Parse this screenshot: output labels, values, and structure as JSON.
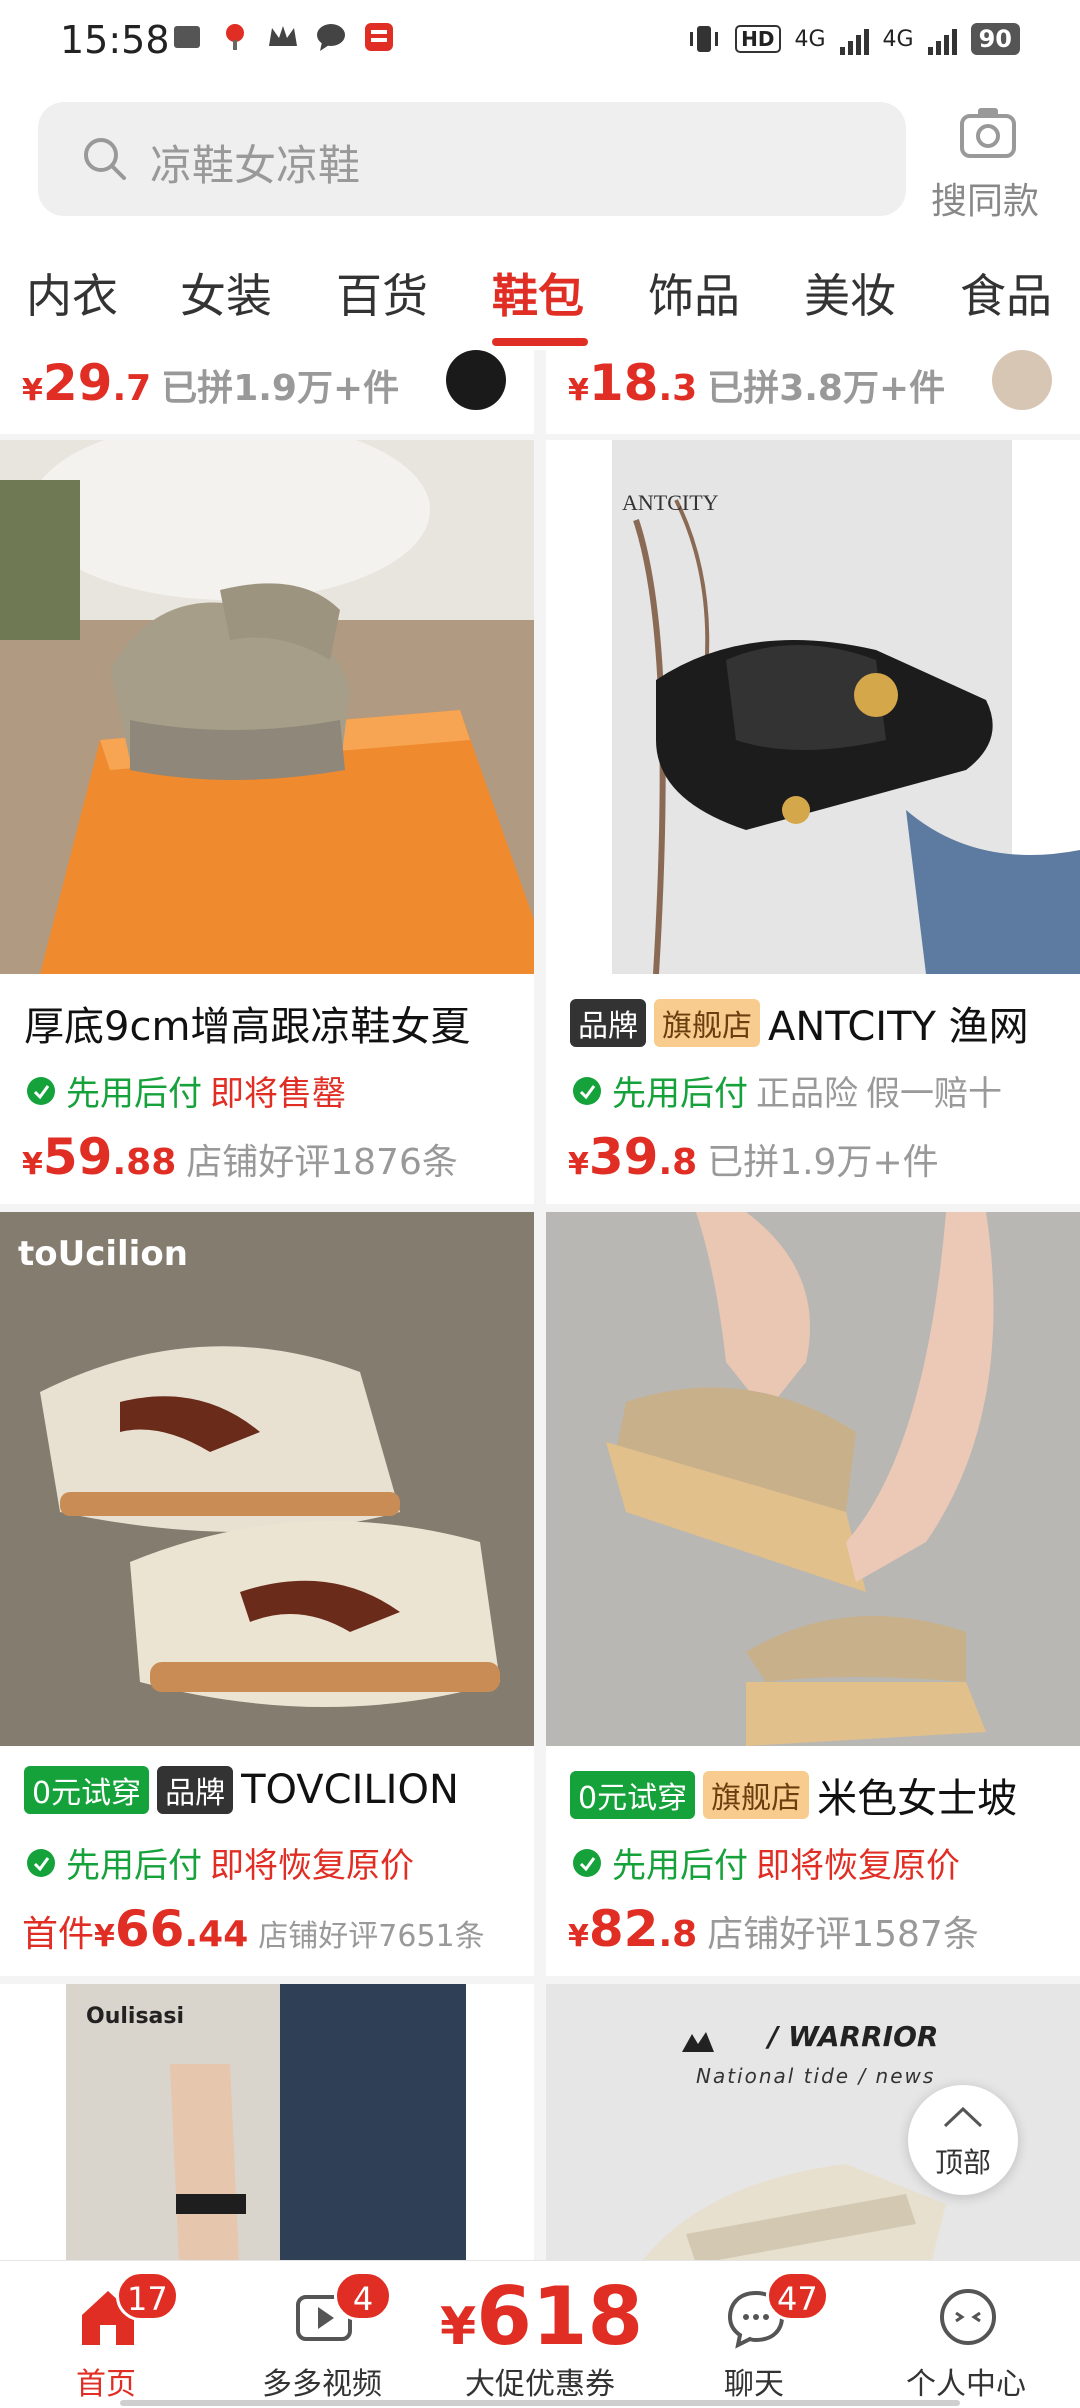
{
  "status_bar": {
    "time": "15:58",
    "hd": "HD",
    "network_1": "4G",
    "network_2": "4G",
    "battery": "90"
  },
  "search": {
    "placeholder": "凉鞋女凉鞋",
    "same_style_label": "搜同款"
  },
  "categories": [
    "内衣",
    "女装",
    "百货",
    "鞋包",
    "饰品",
    "美妆",
    "食品"
  ],
  "active_category": "鞋包",
  "top_row": [
    {
      "yen": "¥",
      "price_int": "29",
      "price_dec": ".7",
      "sold": "已拼1.9万+件"
    },
    {
      "yen": "¥",
      "price_int": "18",
      "price_dec": ".3",
      "sold": "已拼3.8万+件"
    }
  ],
  "products": [
    {
      "title": "厚底9cm增高跟凉鞋女夏",
      "pay_later": "先用后付",
      "extra_1": "即将售罄",
      "yen": "¥",
      "price_int": "59",
      "price_dec": ".88",
      "note": "店铺好评1876条"
    },
    {
      "tag_brand": "品牌",
      "tag_flagship": "旗舰店",
      "title": "ANTCITY 渔网",
      "image_brand_text": "ANTCITY",
      "pay_later": "先用后付",
      "extra_1": "正品险",
      "extra_2": "假一赔十",
      "yen": "¥",
      "price_int": "39",
      "price_dec": ".8",
      "note": "已拼1.9万+件"
    },
    {
      "tag_try": "0元试穿",
      "tag_brand": "品牌",
      "title": "TOVCILION",
      "image_brand_text": "toUcilion",
      "pay_later": "先用后付",
      "extra_1": "即将恢复原价",
      "first_label": "首件",
      "yen": "¥",
      "price_int": "66",
      "price_dec": ".44",
      "note": "店铺好评7651条"
    },
    {
      "tag_try": "0元试穿",
      "tag_flagship": "旗舰店",
      "title": "米色女士坡",
      "pay_later": "先用后付",
      "extra_1": "即将恢复原价",
      "yen": "¥",
      "price_int": "82",
      "price_dec": ".8",
      "note": "店铺好评1587条"
    }
  ],
  "partial_cards": [
    {
      "image_brand_text": "Oulisasi"
    },
    {
      "image_brand_text": "WARRIOR",
      "image_brand_prefix": "/",
      "image_sub_text": "National tide / news"
    }
  ],
  "to_top_label": "顶部",
  "bottom_nav": [
    {
      "label": "首页",
      "badge": "17"
    },
    {
      "label": "多多视频",
      "badge": "4"
    },
    {
      "label": "大促优惠券",
      "promo_yen": "¥",
      "promo_value": "618"
    },
    {
      "label": "聊天",
      "badge": "47"
    },
    {
      "label": "个人中心"
    }
  ],
  "colors": {
    "accent_red": "#e02e24",
    "green": "#16a23b",
    "flagship_tag": "#f8cc8e"
  }
}
